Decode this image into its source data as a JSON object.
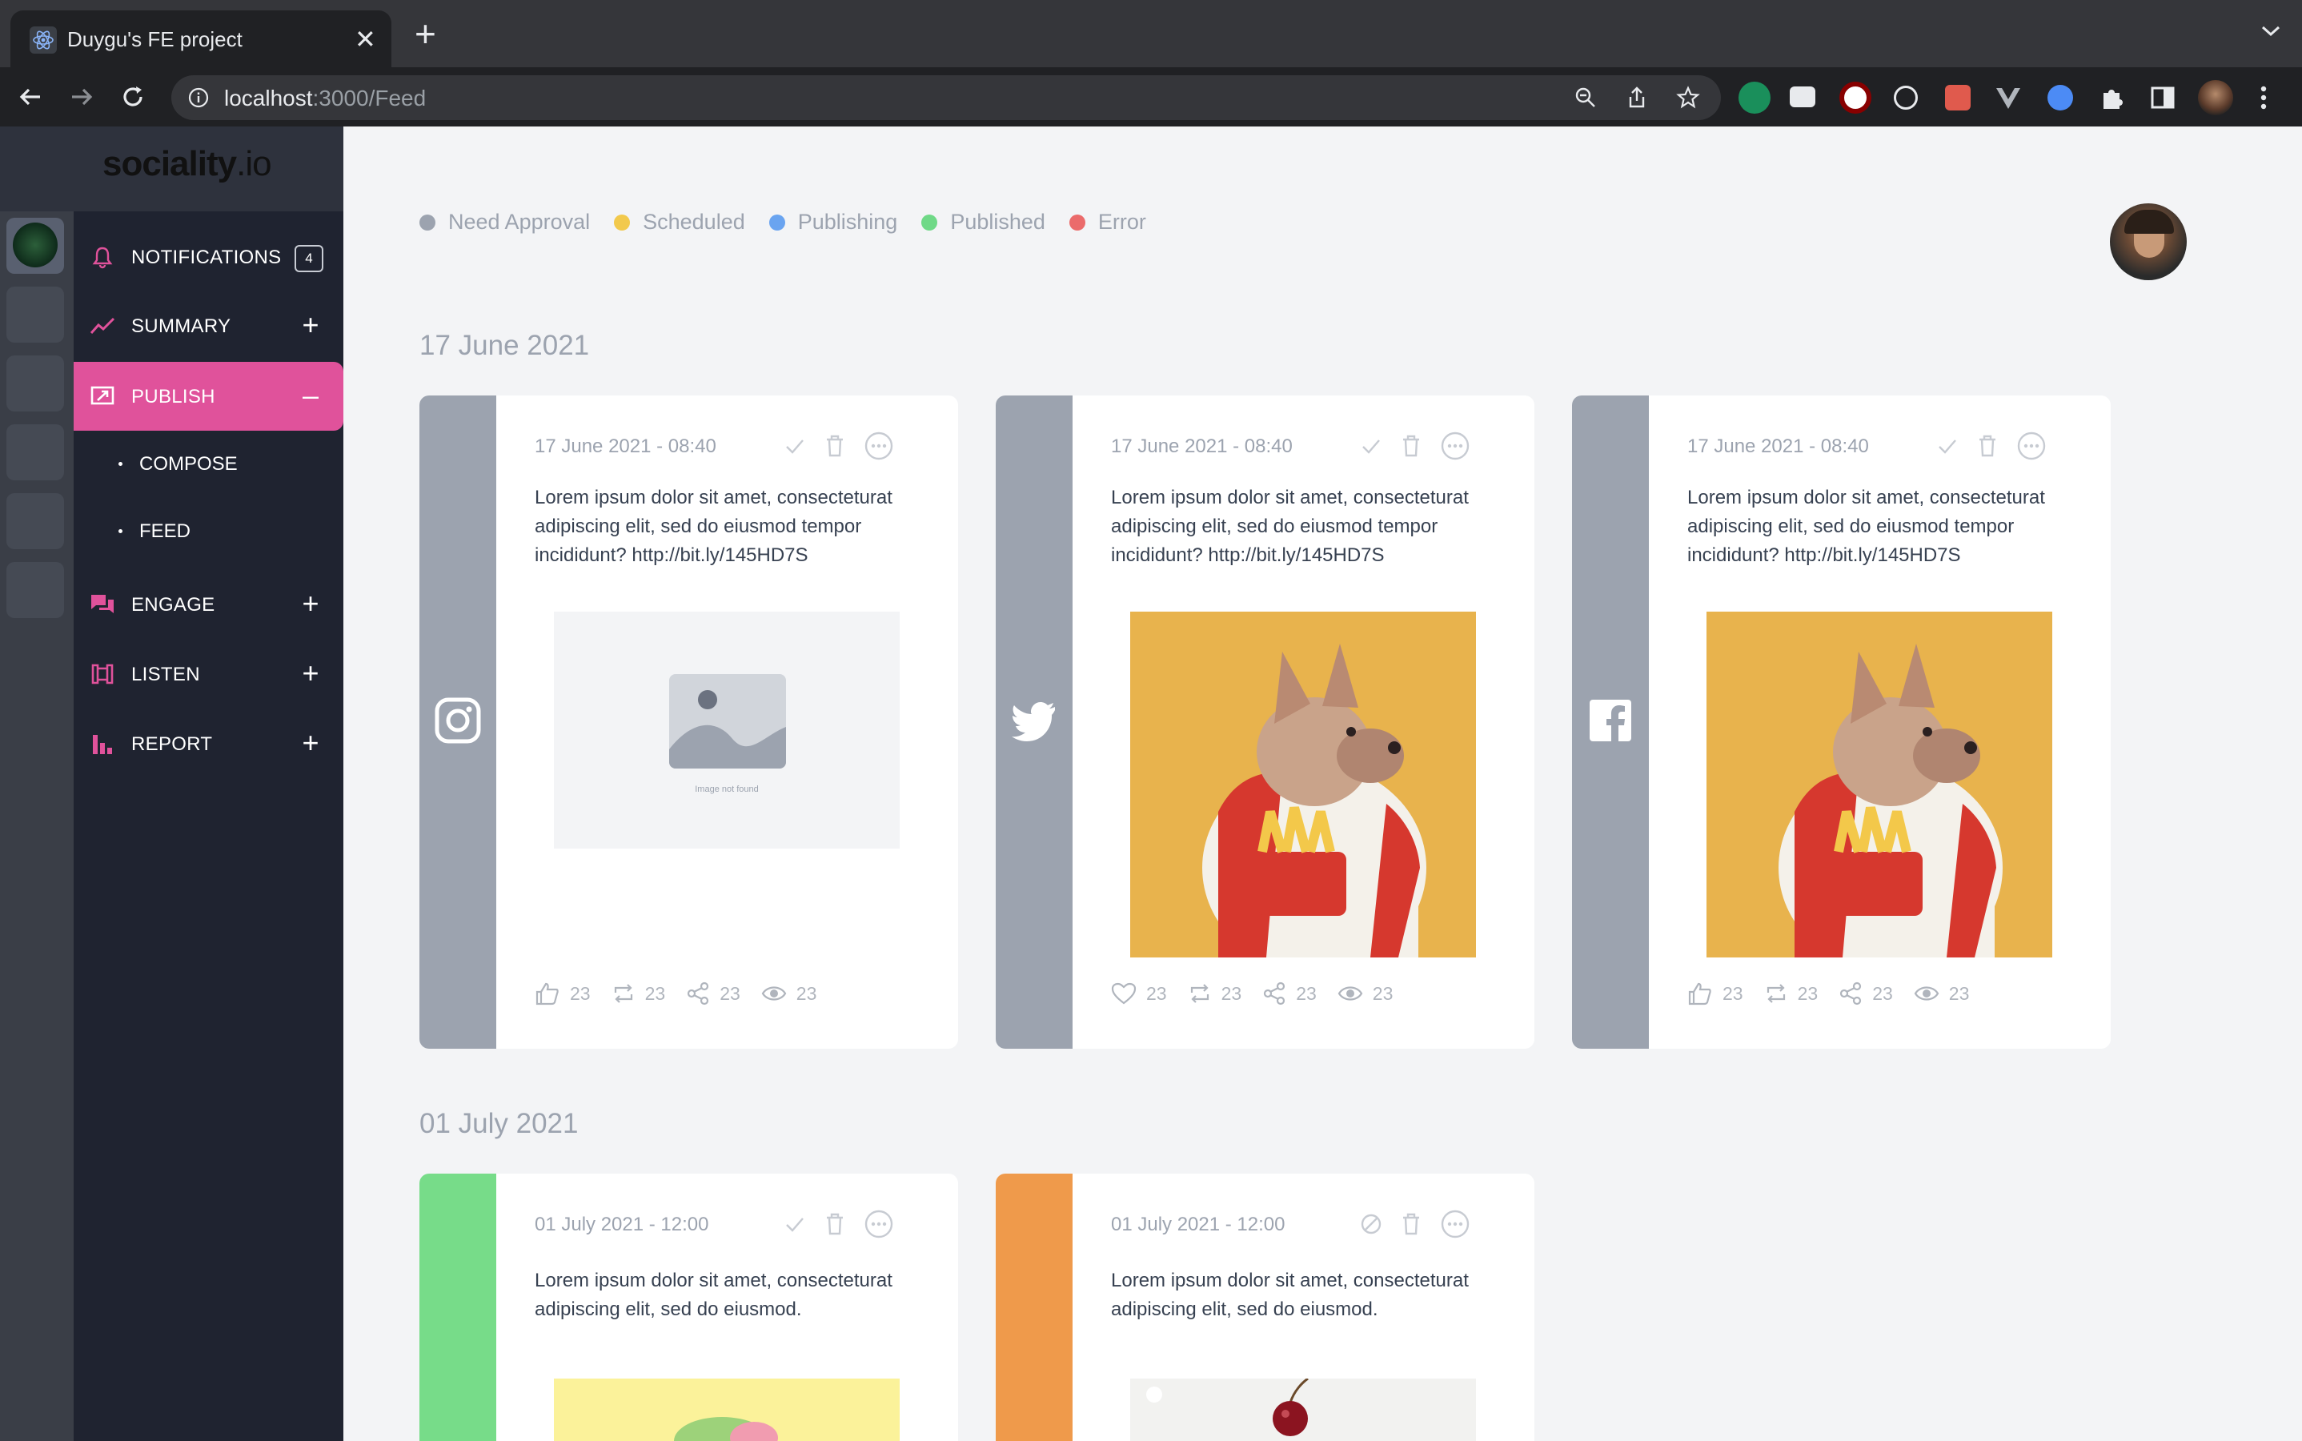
{
  "browser": {
    "tab_title": "Duygu's FE project",
    "url_host": "localhost",
    "url_path": ":3000/Feed"
  },
  "brand": {
    "logo_main": "sociality",
    "logo_suffix": ".io"
  },
  "sidebar": {
    "items": [
      {
        "label": "NOTIFICATIONS",
        "badge": "4"
      },
      {
        "label": "SUMMARY",
        "action": "+"
      },
      {
        "label": "PUBLISH",
        "action": "–"
      },
      {
        "label": "ENGAGE",
        "action": "+"
      },
      {
        "label": "LISTEN",
        "action": "+"
      },
      {
        "label": "REPORT",
        "action": "+"
      }
    ],
    "sub_items": [
      {
        "label": "COMPOSE"
      },
      {
        "label": "FEED"
      }
    ]
  },
  "legend": [
    {
      "label": "Need Approval",
      "color": "#9ca3af"
    },
    {
      "label": "Scheduled",
      "color": "#f2c94c"
    },
    {
      "label": "Publishing",
      "color": "#6aa4f0"
    },
    {
      "label": "Published",
      "color": "#6fd987"
    },
    {
      "label": "Error",
      "color": "#eb6b6b"
    }
  ],
  "groups": [
    {
      "date": "17 June 2021",
      "cards": [
        {
          "network": "instagram-icon",
          "status_color": "#9ca3af",
          "datetime": "17 June 2021 - 08:40",
          "text": "Lorem ipsum dolor sit amet, consecteturat adipiscing elit, sed do eiusmod tempor incididunt? http://bit.ly/145HD7S",
          "image": "placeholder",
          "image_caption": "Image not found",
          "stats": {
            "likes": "23",
            "retweets": "23",
            "shares": "23",
            "views": "23"
          }
        },
        {
          "network": "twitter-icon",
          "status_color": "#9ca3af",
          "datetime": "17 June 2021 - 08:40",
          "text": "Lorem ipsum dolor sit amet, consecteturat adipiscing elit, sed do eiusmod tempor incididunt? http://bit.ly/145HD7S",
          "image": "dog-photo",
          "stats": {
            "likes": "23",
            "retweets": "23",
            "shares": "23",
            "views": "23"
          }
        },
        {
          "network": "facebook-icon",
          "status_color": "#9ca3af",
          "datetime": "17 June 2021 - 08:40",
          "text": "Lorem ipsum dolor sit amet, consecteturat adipiscing elit, sed do eiusmod tempor incididunt? http://bit.ly/145HD7S",
          "image": "dog-photo",
          "stats": {
            "likes": "23",
            "retweets": "23",
            "shares": "23",
            "views": "23"
          }
        }
      ]
    },
    {
      "date": "01 July 2021",
      "cards": [
        {
          "status_color": "#77dc89",
          "datetime": "01 July 2021 - 12:00",
          "text": "Lorem ipsum dolor sit amet, consecteturat adipiscing elit, sed do eiusmod.",
          "image": "yellow-photo"
        },
        {
          "status_color": "#ef9a4b",
          "datetime": "01 July 2021 - 12:00",
          "text": "Lorem ipsum dolor sit amet, consecteturat adipiscing elit, sed do eiusmod.",
          "image": "cherry-photo"
        }
      ]
    }
  ]
}
